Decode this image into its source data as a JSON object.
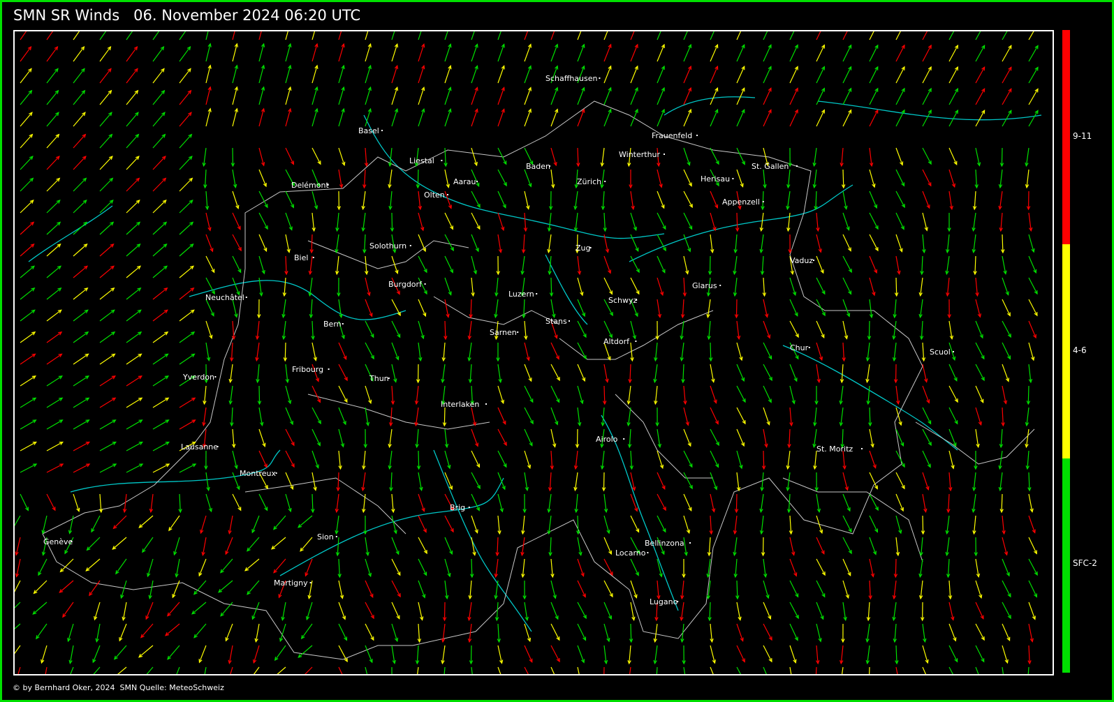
{
  "title": "SMN SR Winds   06. November 2024 06:20 UTC",
  "footer": "© by Bernhard Oker, 2024  SMN Quelle: MeteoSchweiz",
  "colors": {
    "frame": "#00e000",
    "calm": "#00e000",
    "moderate": "#ffff00",
    "strong": "#ff0000",
    "river": "#00c8c8",
    "border": "#c8c8c8"
  },
  "legend": [
    {
      "label": "9-11",
      "color": "#ff0000"
    },
    {
      "label": "4-6",
      "color": "#ffff00"
    },
    {
      "label": "SFC-2",
      "color": "#00e000"
    }
  ],
  "cities": [
    {
      "name": "Schaffhausen"
    },
    {
      "name": "Basel"
    },
    {
      "name": "Liestal"
    },
    {
      "name": "Frauenfeld"
    },
    {
      "name": "Winterthur"
    },
    {
      "name": "Baden"
    },
    {
      "name": "Zürich"
    },
    {
      "name": "Herisau"
    },
    {
      "name": "St. Gallen"
    },
    {
      "name": "Appenzell"
    },
    {
      "name": "Delémont"
    },
    {
      "name": "Aarau"
    },
    {
      "name": "Olten"
    },
    {
      "name": "Solothurn"
    },
    {
      "name": "Zug"
    },
    {
      "name": "Vaduz"
    },
    {
      "name": "Biel"
    },
    {
      "name": "Burgdorf"
    },
    {
      "name": "Glarus"
    },
    {
      "name": "Luzern"
    },
    {
      "name": "Neuchâtel"
    },
    {
      "name": "Schwyz"
    },
    {
      "name": "Bern"
    },
    {
      "name": "Stans"
    },
    {
      "name": "Sarnen"
    },
    {
      "name": "Altdorf"
    },
    {
      "name": "Chur"
    },
    {
      "name": "Scuol"
    },
    {
      "name": "Fribourg"
    },
    {
      "name": "Yverdon"
    },
    {
      "name": "Thun"
    },
    {
      "name": "Interlaken"
    },
    {
      "name": "Airolo"
    },
    {
      "name": "Lausanne"
    },
    {
      "name": "St. Moritz"
    },
    {
      "name": "Montreux"
    },
    {
      "name": "Brig"
    },
    {
      "name": "Sion"
    },
    {
      "name": "Bellinzona"
    },
    {
      "name": "Genève"
    },
    {
      "name": "Locarno"
    },
    {
      "name": "Martigny"
    },
    {
      "name": "Lugano"
    }
  ]
}
